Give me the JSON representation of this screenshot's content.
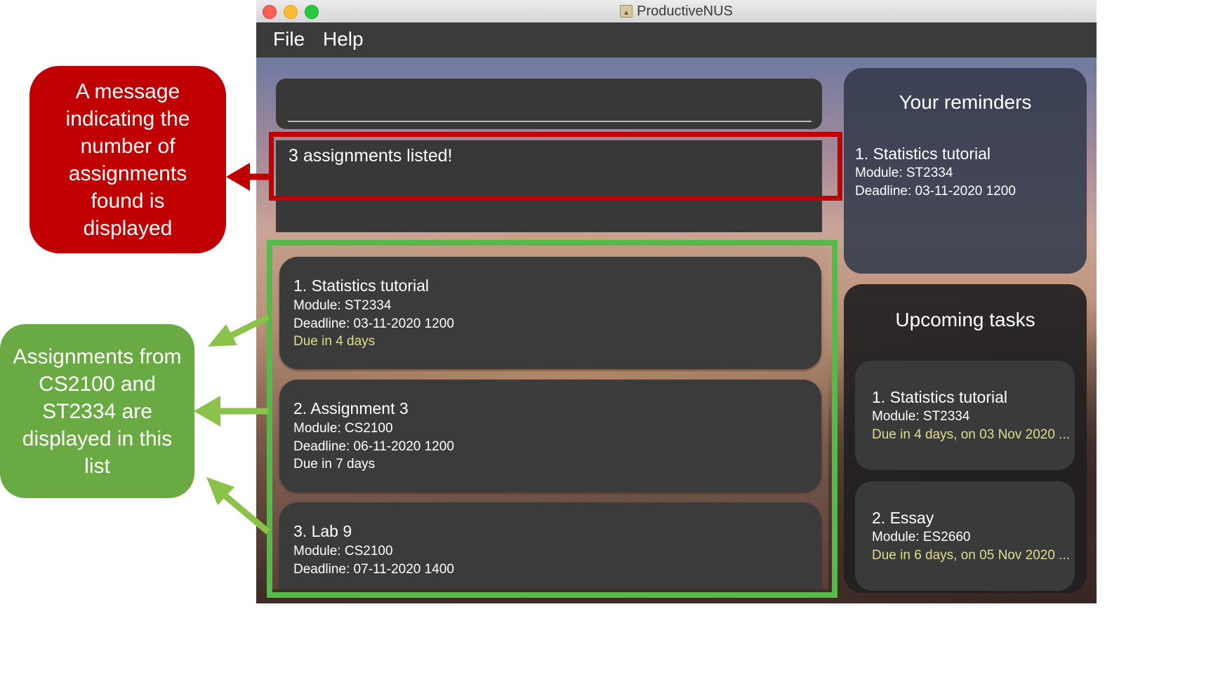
{
  "window": {
    "title": "ProductiveNUS",
    "menu": [
      "File",
      "Help"
    ]
  },
  "command_box": {
    "value": ""
  },
  "result_display": {
    "message": "3 assignments listed!"
  },
  "assignment_list": [
    {
      "title": "1.  Statistics tutorial",
      "module": "Module: ST2334",
      "deadline": "Deadline: 03-11-2020 1200",
      "due": "Due in 4 days",
      "due_highlight": true
    },
    {
      "title": "2.  Assignment 3",
      "module": "Module: CS2100",
      "deadline": "Deadline: 06-11-2020 1200",
      "due": "Due in 7 days",
      "due_highlight": false
    },
    {
      "title": "3.  Lab 9",
      "module": "Module: CS2100",
      "deadline": "Deadline: 07-11-2020 1400"
    }
  ],
  "reminders": {
    "title": "Your reminders",
    "items": [
      {
        "title": "1.  Statistics tutorial",
        "module": "Module: ST2334",
        "deadline": "Deadline: 03-11-2020 1200"
      }
    ]
  },
  "upcoming": {
    "title": "Upcoming tasks",
    "items": [
      {
        "title": "1.  Statistics tutorial",
        "module": "Module: ST2334",
        "due": "Due in 4 days, on 03 Nov 2020 ..."
      },
      {
        "title": "2.  Essay",
        "module": "Module: ES2660",
        "due": "Due in 6 days, on 05 Nov 2020 ..."
      }
    ]
  },
  "annotations": {
    "red_callout": "A message indicating the number of assignments found is displayed",
    "green_callout": "Assignments from CS2100 and ST2334 are displayed in this list"
  },
  "colors": {
    "annotation_red": "#c00000",
    "annotation_green": "#56b949",
    "callout_green": "#6aaa43",
    "due_warning": "#e3dc8f",
    "panel": "#3b3b3b"
  }
}
